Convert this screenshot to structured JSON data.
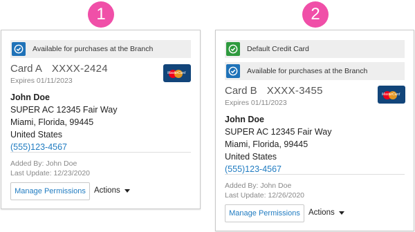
{
  "badges": [
    "1",
    "2"
  ],
  "cards": [
    {
      "tags": [
        {
          "label": "Available for purchases at the Branch",
          "icon": "check-icon",
          "color": "#1f72b8"
        }
      ],
      "card_name": "Card A",
      "card_number": "XXXX-2424",
      "expires": "Expires 01/11/2023",
      "name": "John Doe",
      "address_line1": "SUPER AC 12345 Fair Way",
      "address_line2": "Miami, Florida, 99445",
      "country": "United States",
      "phone": "(555)123-4567",
      "added_by": "Added By: John Doe",
      "last_update": "Last Update: 12/23/2020",
      "manage_label": "Manage Permissions",
      "actions_label": "Actions"
    },
    {
      "tags": [
        {
          "label": "Default Credit Card",
          "icon": "check-icon",
          "color": "#2e9a3e"
        },
        {
          "label": "Available for purchases at the Branch",
          "icon": "check-icon",
          "color": "#1f72b8"
        }
      ],
      "card_name": "Card B",
      "card_number": "XXXX-3455",
      "expires": "Expires 01/11/2023",
      "name": "John Doe",
      "address_line1": "SUPER AC 12345 Fair Way",
      "address_line2": "Miami, Florida, 99445",
      "country": "United States",
      "phone": "(555)123-4567",
      "added_by": "Added By: John Doe",
      "last_update": "Last Update: 12/26/2020",
      "manage_label": "Manage Permissions",
      "actions_label": "Actions"
    }
  ],
  "brand": {
    "mastercard_text": "MasterCard",
    "accent": "#f04fa8",
    "link": "#1f7bc1"
  }
}
